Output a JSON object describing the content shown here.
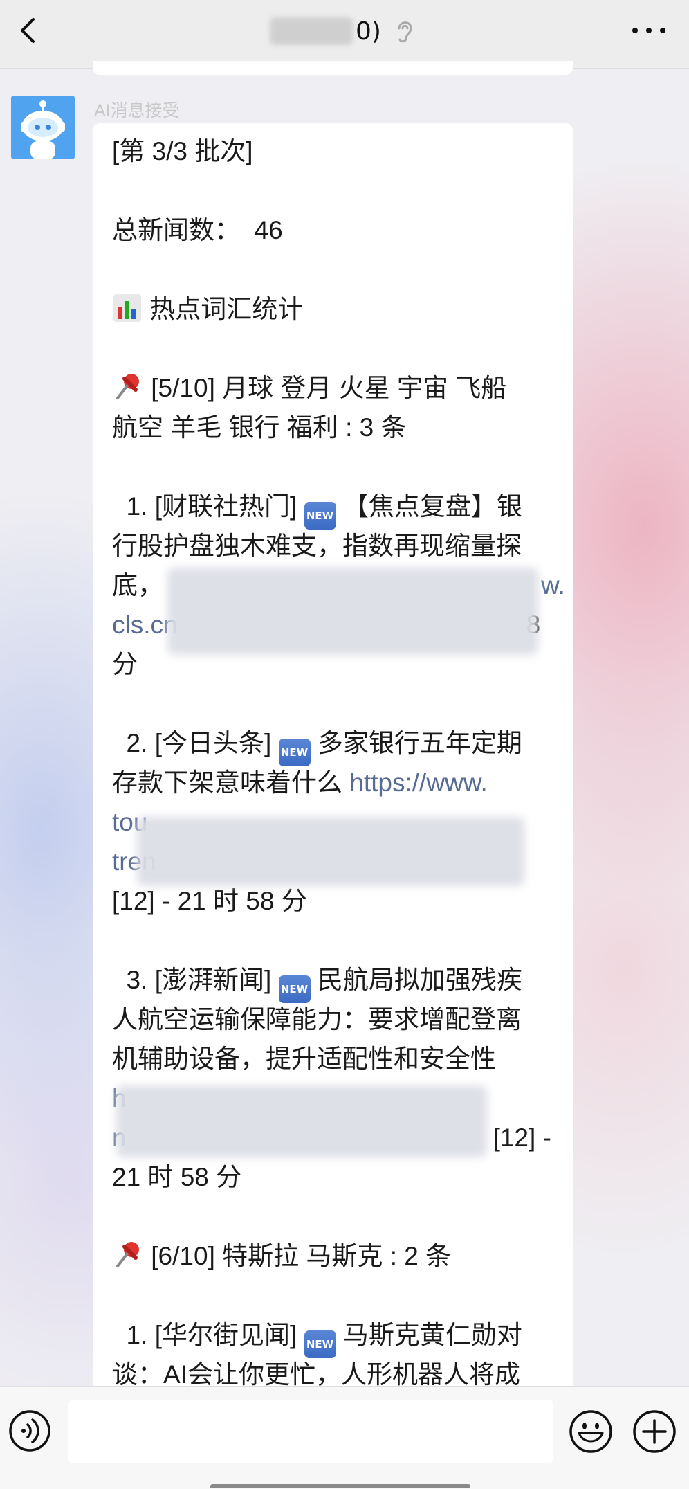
{
  "header": {
    "title_suffix": "0)",
    "back_icon": "chevron-left-icon",
    "ear_icon": "ear-icon",
    "more_icon": "more-dots-icon"
  },
  "message": {
    "sender": "AI消息接受",
    "lines": {
      "l1": "[第 3/3 批次]",
      "l2": "总新闻数：  46",
      "l3": " 热点词汇统计",
      "l4": " [5/10] 月球 登月 火星 宇宙 飞船",
      "l5": "航空 羊毛 银行 福利 : 3 条",
      "l6a": "  1. [财联社热门] ",
      "l6b": " 【焦点复盘】银",
      "l7": "行股护盘独木难支，指数再现缩量探",
      "l8a": "底，",
      "l8b": "w.",
      "l9a": "cls.cn",
      "l9b": "8",
      "l10": "分",
      "l11a": "  2. [今日头条] ",
      "l11b": " 多家银行五年定期",
      "l12a": "存款下架意味着什么 ",
      "l12b": "https://www.",
      "l13": "tou",
      "l14": "tren",
      "l15": "[12] - 21 时 58 分",
      "l16a": "  3. [澎湃新闻] ",
      "l16b": " 民航局拟加强残疾",
      "l17": "人航空运输保障能力：要求增配登离",
      "l18": "机辅助设备，提升适配性和安全性",
      "l19": "h",
      "l20a": "n",
      "l20b": "[12] -",
      "l21": "21 时 58 分",
      "l22": " [6/10] 特斯拉 马斯克 : 2 条",
      "l23a": "  1. [华尔街见闻] ",
      "l23b": " 马斯克黄仁勋对",
      "l24": "谈：AI会让你更忙，人形机器人将成"
    },
    "new_badge": "NEW"
  },
  "inputbar": {
    "voice_icon": "voice-icon",
    "emoji_icon": "emoji-icon",
    "plus_icon": "plus-icon"
  },
  "colors": {
    "link": "#576b95",
    "bubble": "#ffffff",
    "header_bg": "#ededed"
  }
}
